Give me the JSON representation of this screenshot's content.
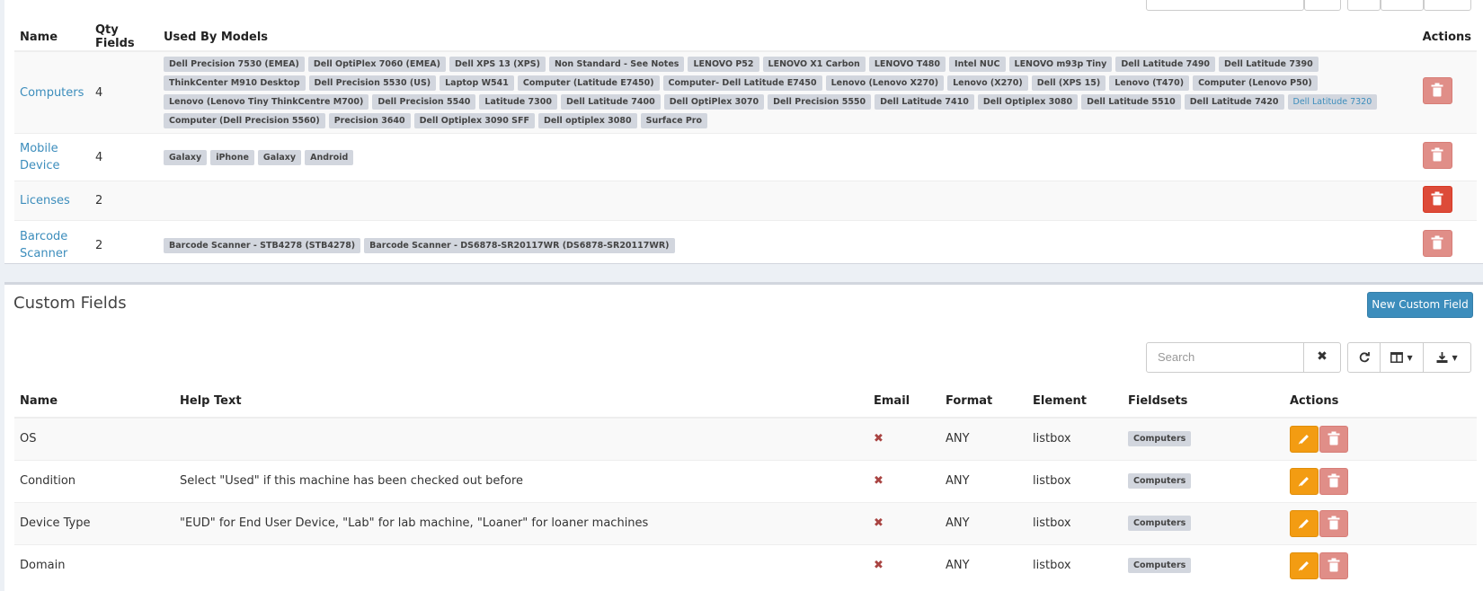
{
  "fieldsets": {
    "headers": {
      "name": "Name",
      "qty": "Qty Fields",
      "models": "Used By Models",
      "actions": "Actions"
    },
    "rows": [
      {
        "name": "Computers",
        "qty": "4",
        "models": [
          "Dell Precision 7530 (EMEA)",
          "Dell OptiPlex 7060 (EMEA)",
          "Dell XPS 13 (XPS)",
          "Non Standard - See Notes",
          "LENOVO P52",
          "LENOVO X1 Carbon",
          "LENOVO T480",
          "Intel NUC",
          "LENOVO m93p Tiny",
          "Dell Latitude 7490",
          "Dell Latitude 7390",
          "ThinkCenter M910 Desktop",
          "Dell Precision 5530 (US)",
          "Laptop W541",
          "Computer (Latitude E7450)",
          "Computer- Dell Latitude E7450",
          "Lenovo (Lenovo X270)",
          "Lenovo (X270)",
          "Dell (XPS 15)",
          "Lenovo (T470)",
          "Computer (Lenovo P50)",
          "Lenovo (Lenovo Tiny ThinkCentre M700)",
          "Dell Precision 5540",
          "Latitude 7300",
          "Dell Latitude 7400",
          "Dell OptiPlex 3070",
          "Dell Precision 5550",
          "Dell Latitude 7410",
          "Dell Optiplex 3080",
          "Dell Latitude 5510",
          "Dell Latitude 7420",
          "Dell Latitude 7320",
          "Computer (Dell Precision 5560)",
          "Precision 3640",
          "Dell Optiplex 3090 SFF",
          "Dell optiplex 3080",
          "Surface Pro"
        ],
        "highlighted_model": "Dell Latitude 7320",
        "delete_active": false
      },
      {
        "name": "Mobile Device",
        "qty": "4",
        "models": [
          "Galaxy",
          "iPhone",
          "Galaxy",
          "Android"
        ],
        "delete_active": false
      },
      {
        "name": "Licenses",
        "qty": "2",
        "models": [],
        "delete_active": true
      },
      {
        "name": "Barcode Scanner",
        "qty": "2",
        "models": [
          "Barcode Scanner - STB4278 (STB4278)",
          "Barcode Scanner - DS6878-SR20117WR (DS6878-SR20117WR)"
        ],
        "delete_active": false
      }
    ]
  },
  "custom_fields": {
    "title": "Custom Fields",
    "new_button": "New Custom Field",
    "search_placeholder": "Search",
    "headers": {
      "name": "Name",
      "help": "Help Text",
      "email": "Email",
      "format": "Format",
      "element": "Element",
      "fieldsets": "Fieldsets",
      "actions": "Actions"
    },
    "rows": [
      {
        "name": "OS",
        "help": "",
        "format": "ANY",
        "element": "listbox",
        "fieldset": "Computers"
      },
      {
        "name": "Condition",
        "help": "Select \"Used\" if this machine has been checked out before",
        "format": "ANY",
        "element": "listbox",
        "fieldset": "Computers"
      },
      {
        "name": "Device Type",
        "help": "\"EUD\" for End User Device, \"Lab\" for lab machine, \"Loaner\" for loaner machines",
        "format": "ANY",
        "element": "listbox",
        "fieldset": "Computers"
      },
      {
        "name": "Domain",
        "help": "",
        "format": "ANY",
        "element": "listbox",
        "fieldset": "Computers"
      }
    ]
  },
  "icons": {
    "clear": "times-icon",
    "refresh": "refresh-icon",
    "columns": "columns-icon",
    "export": "download-icon",
    "email_no": "times-icon"
  },
  "colors": {
    "link": "#3c8dbc",
    "danger": "#dd4b39",
    "warning": "#f39c12",
    "primary": "#3c8dbc"
  }
}
